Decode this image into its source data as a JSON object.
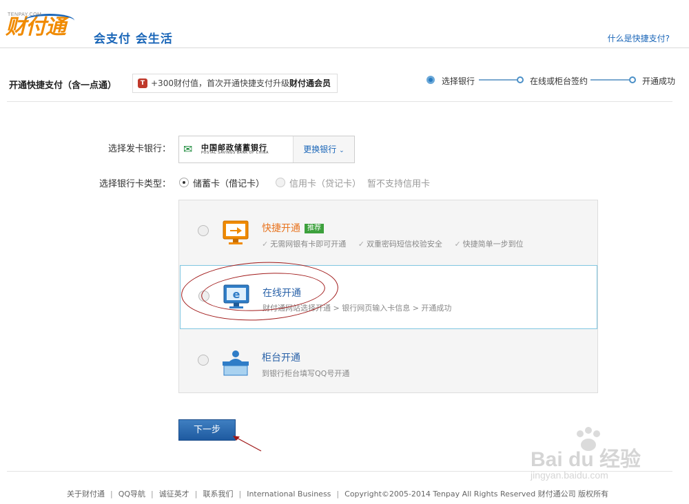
{
  "header": {
    "logo_small": "TENPAY.COM",
    "logo_main": "财付通",
    "slogan": "会支付 会生活",
    "help_link": "什么是快捷支付?"
  },
  "title_row": {
    "title": "开通快捷支付（含一点通）",
    "promo_text": "+300财付值，首次开通快捷支付升级",
    "promo_bold": "财付通会员",
    "steps": [
      "选择银行",
      "在线或柜台签约",
      "开通成功"
    ]
  },
  "form": {
    "bank_label": "选择发卡银行：",
    "bank_name_cn": "中国邮政储蓄银行",
    "bank_name_en": "POSTAL SAVINGS BANK OF CHINA",
    "change_bank": "更换银行",
    "card_type_label": "选择银行卡类型：",
    "card_types": [
      {
        "label": "储蓄卡（借记卡）",
        "checked": true
      },
      {
        "label": "信用卡（贷记卡）",
        "checked": false,
        "disabled": true
      }
    ],
    "credit_note": "暂不支持信用卡"
  },
  "options": [
    {
      "title": "快捷开通",
      "tag": "推荐",
      "features": [
        "无需网银有卡即可开通",
        "双重密码短信校验安全",
        "快捷简单一步到位"
      ],
      "icon": "monitor-arrow-icon"
    },
    {
      "title": "在线开通",
      "desc": "财付通网站选择开通 > 银行网页输入卡信息 > 开通成功",
      "icon": "monitor-ie-icon"
    },
    {
      "title": "柜台开通",
      "desc": "到银行柜台填写QQ号开通",
      "icon": "counter-person-icon"
    }
  ],
  "next_button": "下一步",
  "footer": {
    "links": [
      "关于财付通",
      "QQ导航",
      "诚征英才",
      "联系我们",
      "International Business"
    ],
    "copyright": "Copyright©2005-2014 Tenpay All Rights Reserved 财付通公司 版权所有"
  },
  "watermark": {
    "text": "Bai du 经验",
    "url": "jingyan.baidu.com"
  },
  "colors": {
    "brand_blue": "#1a66b8",
    "brand_orange": "#f08a00",
    "selected_border": "#7ec5e0",
    "annotation_red": "#a01818"
  }
}
